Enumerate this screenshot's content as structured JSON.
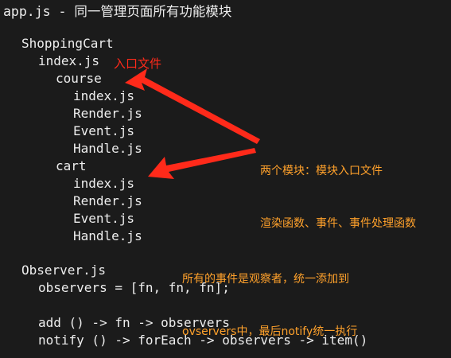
{
  "header": "app.js - 同一管理页面所有功能模块",
  "tree": {
    "root": "ShoppingCart",
    "entry": "index.js",
    "entry_note": "入口文件",
    "course": {
      "name": "course",
      "files": [
        "index.js",
        "Render.js",
        "Event.js",
        "Handle.js"
      ]
    },
    "cart": {
      "name": "cart",
      "files": [
        "index.js",
        "Render.js",
        "Event.js",
        "Handle.js"
      ]
    }
  },
  "notes": {
    "modules_line1": "两个模块：模块入口文件",
    "modules_line2": "渲染函数、事件、事件处理函数",
    "observers_line1": "所有的事件是观察者，统一添加到",
    "observers_line2": "ovservers中，最后notify统一执行"
  },
  "observer": {
    "file": "Observer.js",
    "decl": "observers = [fn, fn, fn];",
    "add": "add () -> fn -> observers",
    "notify": "notify () -> forEach -> observers -> item()"
  },
  "colors": {
    "background": "#1b1b1b",
    "code_text": "#ededed",
    "red_accent": "#ff2a1a",
    "orange_accent": "#ffa12b"
  }
}
